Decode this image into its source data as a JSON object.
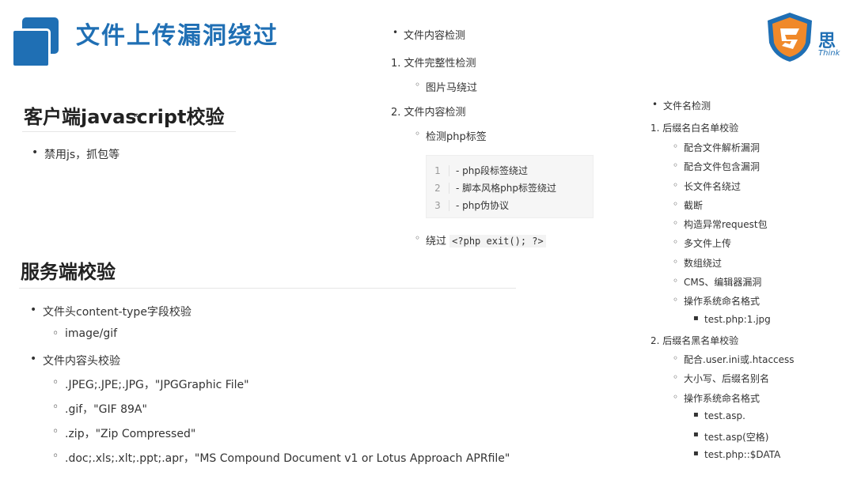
{
  "header": {
    "title": "文件上传漏洞绕过",
    "brand_text": "思",
    "brand_sub": "Think",
    "colors": {
      "accent": "#1f6fb4",
      "shield_orange": "#f0892a"
    }
  },
  "client": {
    "heading": "客户端javascript校验",
    "items": [
      "禁用js，抓包等"
    ]
  },
  "server": {
    "heading": "服务端校验",
    "item1": "文件头content-type字段校验",
    "item1_sub": "image/gif",
    "item2": "文件内容头校验",
    "item2_subs": [
      ".JPEG;.JPE;.JPG，\"JPGGraphic File\"",
      ".gif，\"GIF 89A\"",
      ".zip，\"Zip Compressed\"",
      ".doc;.xls;.xlt;.ppt;.apr，\"MS Compound Document v1 or Lotus Approach APRfile\""
    ]
  },
  "content_check": {
    "bullet": "文件内容检测",
    "n1": "1. 文件完整性检测",
    "n1_sub": "图片马绕过",
    "n2": "2. 文件内容检测",
    "n2_sub": "检测php标签",
    "code_lines": [
      {
        "num": "1",
        "text": "-     php段标签绕过"
      },
      {
        "num": "2",
        "text": "-     脚本风格php标签绕过"
      },
      {
        "num": "3",
        "text": "-     php伪协议"
      }
    ],
    "bypass_prefix": "绕过",
    "bypass_code": "<?php exit(); ?>"
  },
  "filename_check": {
    "bullet": "文件名检测",
    "n1": "1. 后缀名白名单校验",
    "n1_subs": [
      "配合文件解析漏洞",
      "配合文件包含漏洞",
      "长文件名绕过",
      "截断",
      "构造异常request包",
      "多文件上传",
      "数组绕过",
      "CMS、编辑器漏洞",
      "操作系统命名格式"
    ],
    "n1_last_sub": "test.php:1.jpg",
    "n2": "2. 后缀名黑名单校验",
    "n2_subs": [
      "配合.user.ini或.htaccess",
      "大小写、后缀名别名",
      "操作系统命名格式"
    ],
    "n2_last_subs": [
      "test.asp.",
      "test.asp(空格)",
      "test.php::$DATA"
    ]
  }
}
